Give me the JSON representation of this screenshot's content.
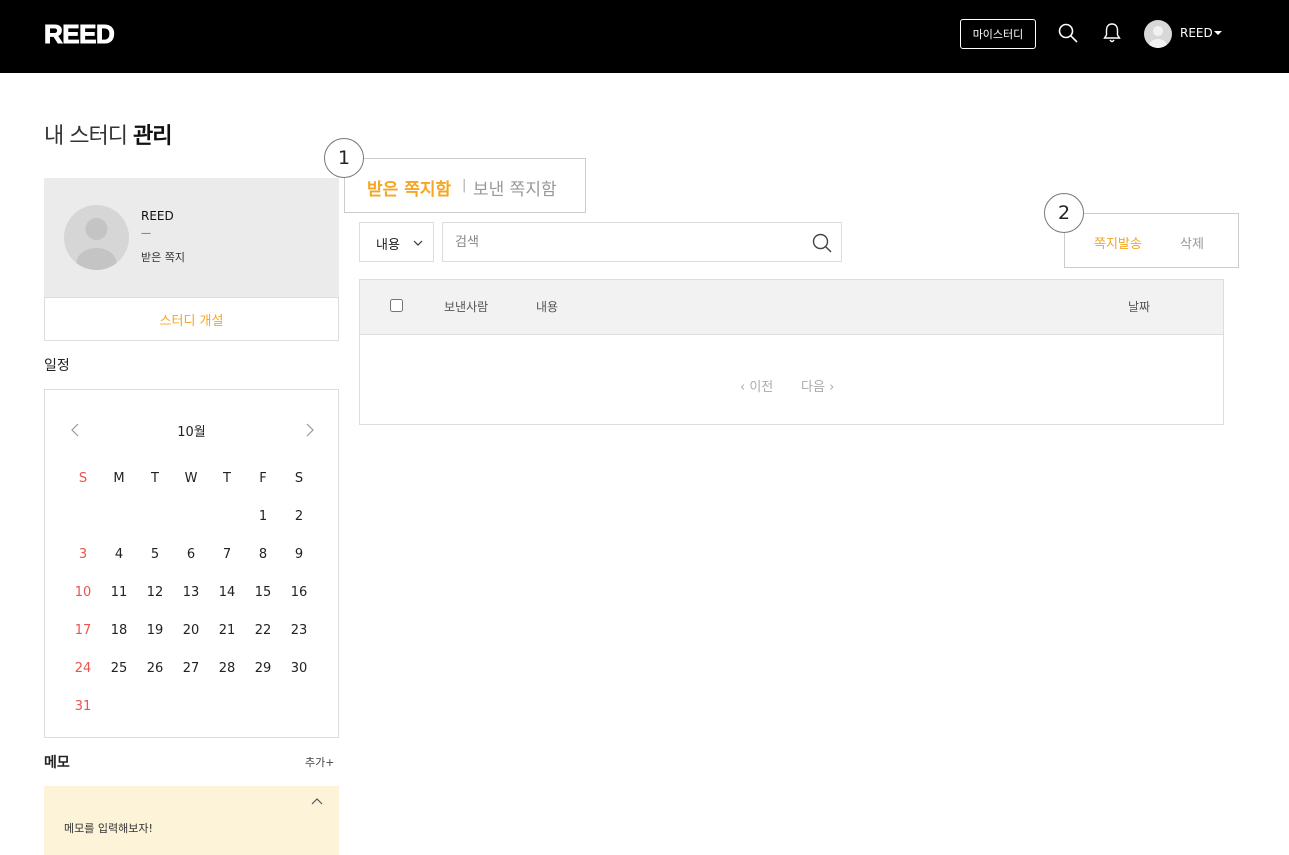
{
  "header": {
    "logo": "REED",
    "my_study_label": "마이스터디",
    "user_name": "REED"
  },
  "page": {
    "title_regular": "내 스터디",
    "title_bold": "관리"
  },
  "profile": {
    "name": "REED",
    "dash": "—",
    "inbox_label": "받은 쪽지",
    "open_study_label": "스터디 개설"
  },
  "schedule": {
    "label": "일정",
    "month": "10월",
    "weekdays": [
      "S",
      "M",
      "T",
      "W",
      "T",
      "F",
      "S"
    ],
    "weeks": [
      [
        "",
        "",
        "",
        "",
        "",
        "1",
        "2"
      ],
      [
        "3",
        "4",
        "5",
        "6",
        "7",
        "8",
        "9"
      ],
      [
        "10",
        "11",
        "12",
        "13",
        "14",
        "15",
        "16"
      ],
      [
        "17",
        "18",
        "19",
        "20",
        "21",
        "22",
        "23"
      ],
      [
        "24",
        "25",
        "26",
        "27",
        "28",
        "29",
        "30"
      ],
      [
        "31",
        "",
        "",
        "",
        "",
        "",
        ""
      ]
    ],
    "sunday_color": "#e8554e"
  },
  "memo": {
    "label": "메모",
    "add_label": "추가+",
    "text": "메모를 입력해보자!"
  },
  "tabs": {
    "received": "받은 쪽지함",
    "separator": "|",
    "sent": "보낸 쪽지함"
  },
  "markers": {
    "one": "1",
    "two": "2"
  },
  "search": {
    "filter_selected": "내용",
    "placeholder": "검색"
  },
  "actions": {
    "send_label": "쪽지발송",
    "delete_label": "삭제"
  },
  "table": {
    "columns": [
      "보낸사람",
      "내용",
      "날짜"
    ],
    "prev_label": "이전",
    "next_label": "다음"
  },
  "colors": {
    "accent": "#f5a623",
    "header_bg": "#000000",
    "memo_bg": "#fdf3d8"
  }
}
